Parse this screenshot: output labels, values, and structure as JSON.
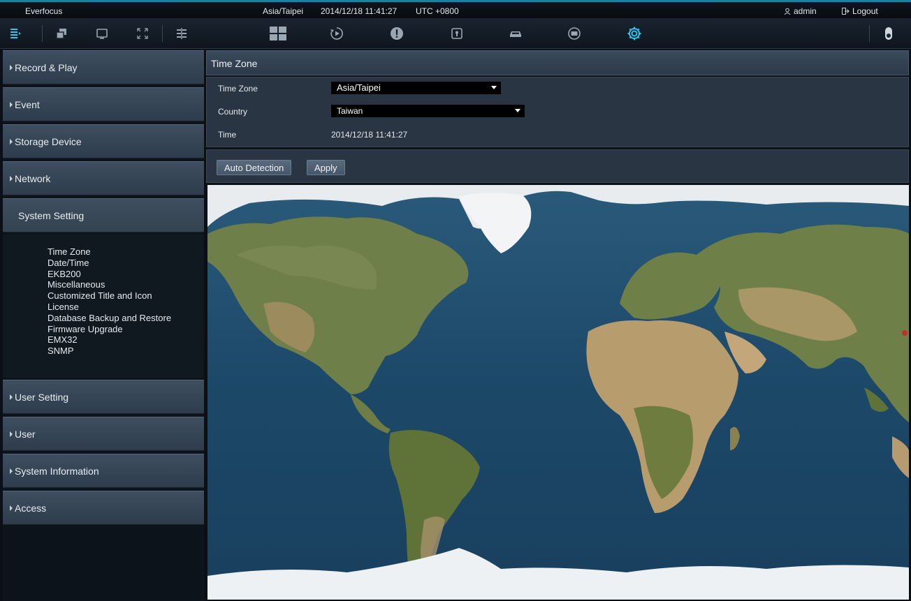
{
  "status_bar": {
    "brand": "Everfocus",
    "timezone": "Asia/Taipei",
    "datetime": "2014/12/18 11:41:27",
    "utc": "UTC +0800",
    "user": "admin",
    "logout": "Logout"
  },
  "toolbar": {
    "icons": [
      "menu-icon",
      "window-icon",
      "monitor-icon",
      "fullscreen-icon",
      "layout-icon",
      "grid-icon",
      "playback-icon",
      "alarm-icon",
      "lock-icon",
      "vehicle-icon",
      "sensor-icon",
      "settings-icon",
      "power-icon"
    ],
    "accent_color": "#2ec4f0",
    "active": "settings-icon"
  },
  "sidebar": {
    "items": [
      {
        "label": "Record & Play"
      },
      {
        "label": "Event"
      },
      {
        "label": "Storage Device"
      },
      {
        "label": "Network"
      },
      {
        "label": "System Setting"
      },
      {
        "label": "User Setting"
      },
      {
        "label": "User"
      },
      {
        "label": "System Information"
      },
      {
        "label": "Access"
      }
    ],
    "active": "System Setting",
    "sub_items": [
      "Time Zone",
      "Date/Time",
      "EKB200",
      "Miscellaneous",
      "Customized Title and Icon",
      "License",
      "Database Backup and Restore",
      "Firmware Upgrade",
      "EMX32",
      "SNMP"
    ]
  },
  "main": {
    "title": "Time Zone",
    "form": {
      "timezone_label": "Time Zone",
      "timezone_value": "Asia/Taipei",
      "country_label": "Country",
      "country_value": "Taiwan",
      "time_label": "Time",
      "time_value": "2014/12/18 11:41:27"
    },
    "buttons": {
      "auto_detection": "Auto Detection",
      "apply": "Apply"
    }
  }
}
